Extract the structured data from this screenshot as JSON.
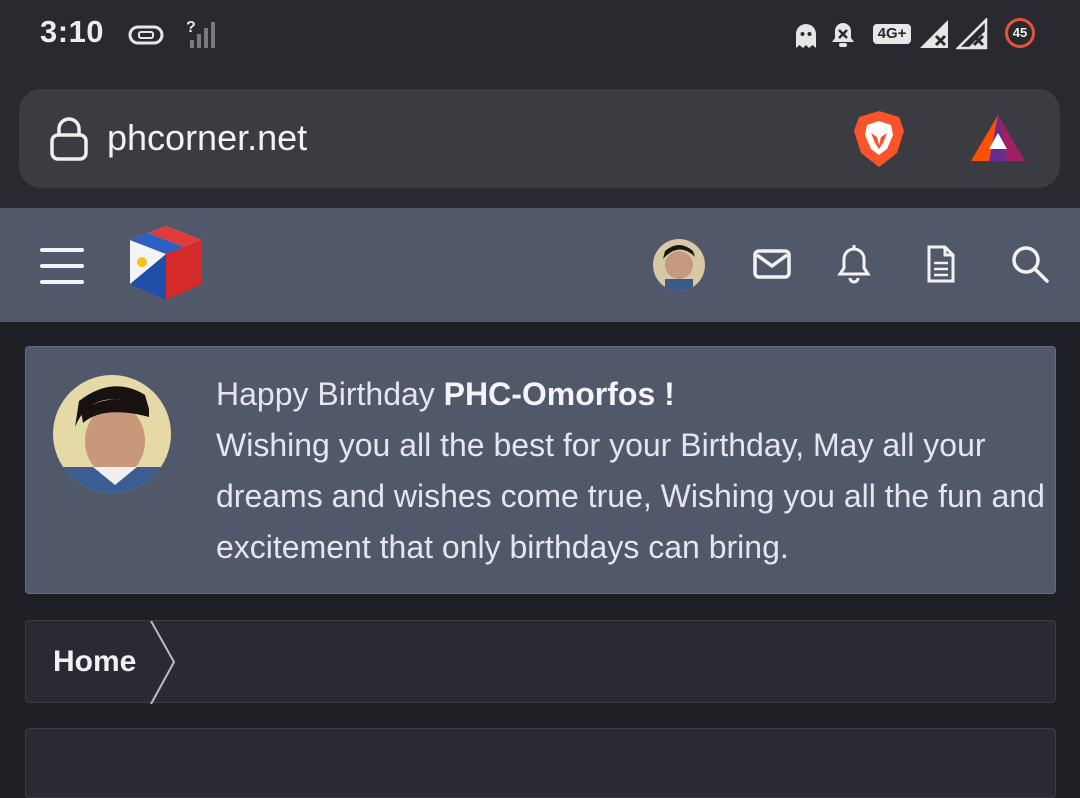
{
  "status_bar": {
    "time": "3:10",
    "network_badge": "4G+",
    "battery": "45",
    "icons": [
      "vpn-icon",
      "signal-unknown-icon",
      "ghost-icon",
      "notifications-muted-icon",
      "network-4g-icon",
      "signal-x-icon",
      "signal-x-icon",
      "battery-icon"
    ]
  },
  "browser": {
    "url": "phcorner.net",
    "icons": [
      "lock-icon",
      "brave-shields-icon",
      "brave-rewards-icon"
    ]
  },
  "site_header": {
    "icons": [
      "hamburger-menu-icon",
      "site-logo",
      "user-avatar",
      "mail-icon",
      "bell-icon",
      "document-icon",
      "search-icon"
    ]
  },
  "birthday": {
    "greeting_prefix": "Happy Birthday ",
    "username": "PHC-Omorfos !",
    "message": "Wishing you all the best for your Birthday, May all your dreams and wishes come true, Wishing you all the fun and excitement that only birthdays can bring."
  },
  "breadcrumb": {
    "home": "Home"
  },
  "colors": {
    "status_bg": "#29292f",
    "header_bg": "#505869",
    "page_bg": "#1f2026",
    "battery_ring": "#e2553a",
    "brave_orange": "#fb542b"
  }
}
